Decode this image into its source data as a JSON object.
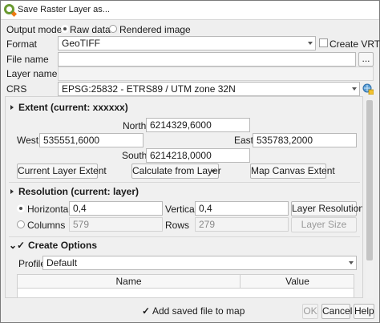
{
  "window": {
    "title": "Save Raster Layer as..."
  },
  "output_mode": {
    "label": "Output mode",
    "options": [
      "Raw data",
      "Rendered image"
    ],
    "selected": "Raw data"
  },
  "format": {
    "label": "Format",
    "value": "GeoTIFF",
    "create_vrt_label": "Create VRT"
  },
  "file_name": {
    "label": "File name",
    "value": "",
    "browse_label": "..."
  },
  "layer_name": {
    "label": "Layer name",
    "value": ""
  },
  "crs": {
    "label": "CRS",
    "value": "EPSG:25832 - ETRS89 / UTM zone 32N"
  },
  "extent": {
    "title": "Extent (current: xxxxxx)",
    "north_label": "North",
    "north": "6214329,6000",
    "west_label": "West",
    "west": "535551,6000",
    "east_label": "East",
    "east": "535783,2000",
    "south_label": "South",
    "south": "6214218,0000",
    "current_layer_button": "Current Layer Extent",
    "calculate_from_layer_button": "Calculate from Layer",
    "map_canvas_button": "Map Canvas Extent"
  },
  "resolution": {
    "title": "Resolution (current: layer)",
    "horizontal_label": "Horizontal",
    "horizontal": "0,4",
    "vertical_label": "Vertical",
    "vertical": "0,4",
    "layer_resolution_button": "Layer Resolution",
    "columns_label": "Columns",
    "columns": "579",
    "rows_label": "Rows",
    "rows": "279",
    "layer_size_button": "Layer Size"
  },
  "create_options": {
    "title": "Create Options",
    "check_mark": "✓",
    "profile_label": "Profile",
    "profile_value": "Default",
    "table_headers": [
      "Name",
      "Value"
    ]
  },
  "footer": {
    "check_mark": "✓",
    "add_saved_label": "Add saved file to map",
    "ok": "OK",
    "cancel": "Cancel",
    "help": "Help"
  }
}
